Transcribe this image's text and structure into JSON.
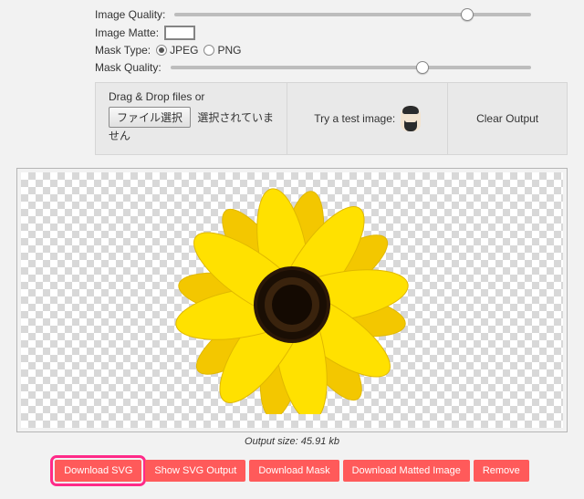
{
  "controls": {
    "image_quality_label": "Image Quality:",
    "image_quality_pct": 82,
    "image_matte_label": "Image Matte:",
    "matte_color": "#ffffff",
    "mask_type_label": "Mask Type:",
    "mask_type_options": {
      "jpeg": "JPEG",
      "png": "PNG"
    },
    "mask_type_selected": "jpeg",
    "mask_quality_label": "Mask Quality:",
    "mask_quality_pct": 70
  },
  "panel": {
    "drag_hint": "Drag & Drop files or",
    "file_button": "ファイル選択",
    "file_status": "選択されていません",
    "try_label": "Try a test image:",
    "clear_label": "Clear Output"
  },
  "output": {
    "caption_prefix": "Output size: ",
    "size_text": "45.91 kb"
  },
  "buttons": {
    "download_svg": "Download SVG",
    "show_svg": "Show SVG Output",
    "download_mask": "Download Mask",
    "download_matted": "Download Matted Image",
    "remove": "Remove"
  },
  "colors": {
    "accent": "#ff5a5a",
    "highlight": "#ff2a88"
  }
}
